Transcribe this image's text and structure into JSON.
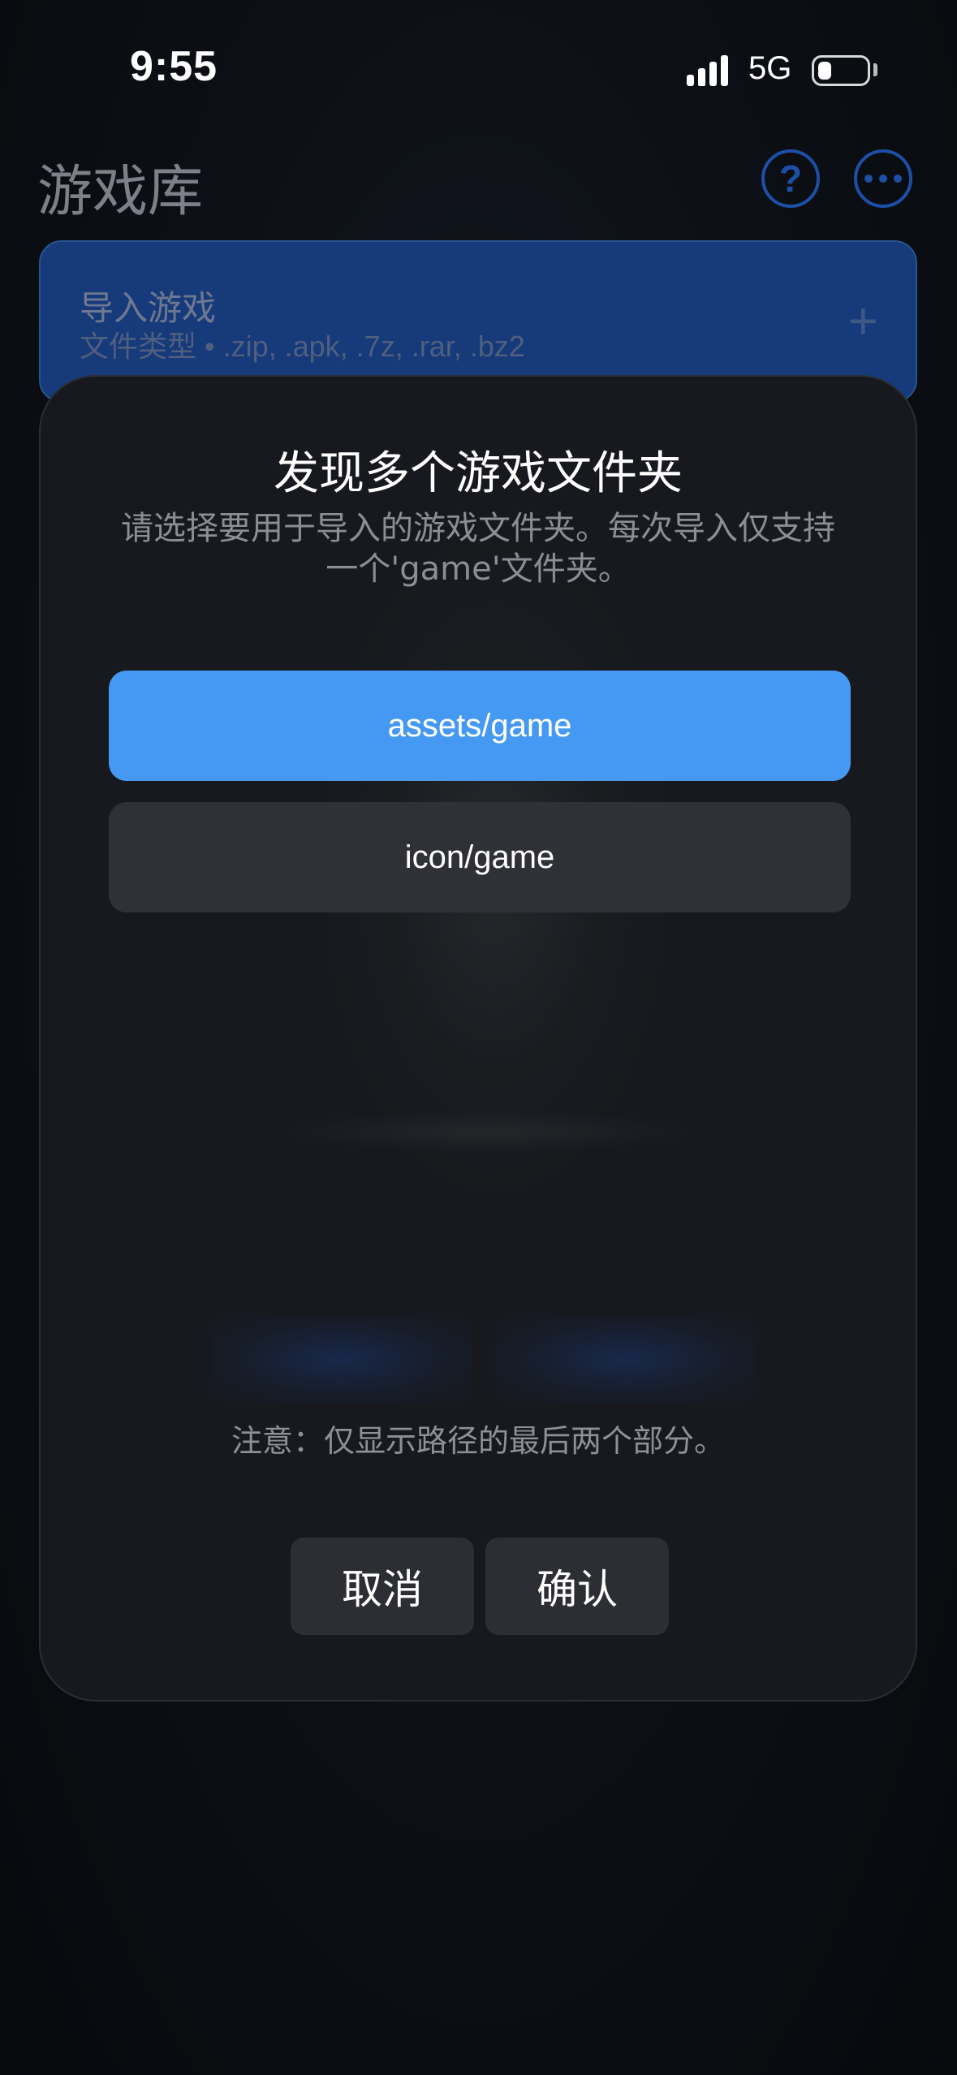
{
  "status_bar": {
    "time": "9:55",
    "network": "5G",
    "icons": [
      "signal-icon",
      "battery-icon"
    ]
  },
  "header": {
    "title": "游戏库",
    "help_icon": "?",
    "more_icon": "more-icon"
  },
  "import_card": {
    "title": "导入游戏",
    "subtitle": "文件类型 • .zip, .apk, .7z, .rar, .bz2",
    "plus": "+"
  },
  "dialog": {
    "title": "发现多个游戏文件夹",
    "description": "请选择要用于导入的游戏文件夹。每次导入仅支持一个'game'文件夹。",
    "folders": [
      {
        "label": "assets/game",
        "selected": true
      },
      {
        "label": "icon/game",
        "selected": false
      }
    ],
    "note": "注意：仅显示路径的最后两个部分。",
    "cancel_label": "取消",
    "confirm_label": "确认"
  },
  "colors": {
    "accent": "#4699f2",
    "primary_blue": "#1d4fa6",
    "dialog_bg": "#17191e"
  }
}
